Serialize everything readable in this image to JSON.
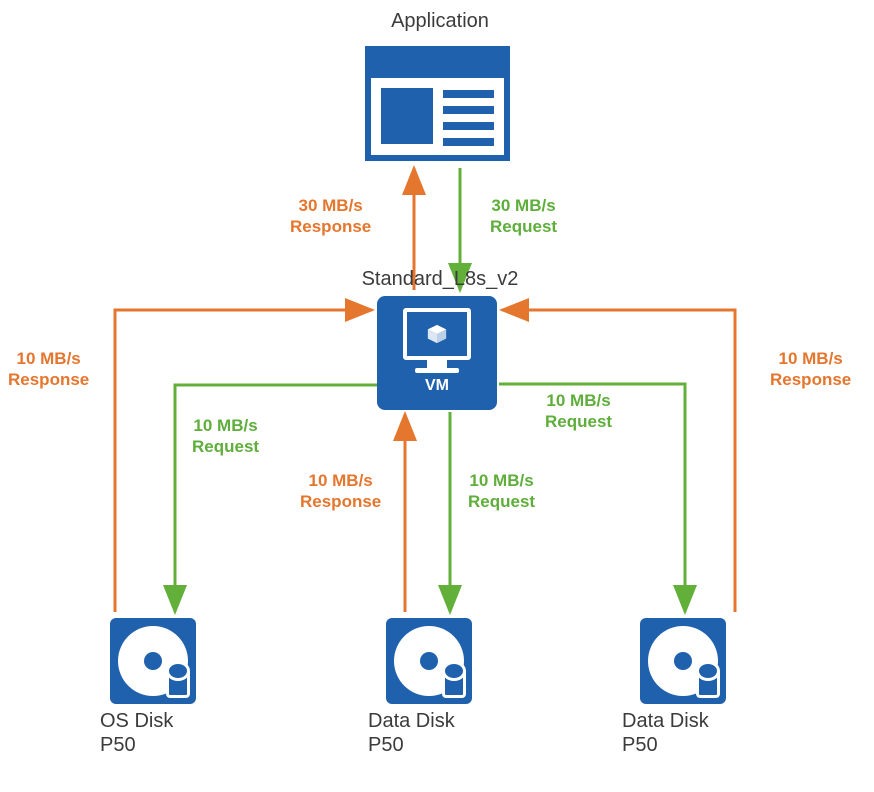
{
  "title": "Application",
  "vm": {
    "sku": "Standard_L8s_v2",
    "label": "VM"
  },
  "disks": {
    "os": {
      "name": "OS Disk",
      "tier": "P50"
    },
    "data1": {
      "name": "Data Disk",
      "tier": "P50"
    },
    "data2": {
      "name": "Data Disk",
      "tier": "P50"
    }
  },
  "flows": {
    "app_request": "30 MB/s\nRequest",
    "app_response": "30 MB/s\nResponse",
    "os_request": "10 MB/s\nRequest",
    "os_response": "10 MB/s\nResponse",
    "d1_request": "10 MB/s\nRequest",
    "d1_response": "10 MB/s\nResponse",
    "d2_request": "10 MB/s\nRequest",
    "d2_response": "10 MB/s\nResponse"
  },
  "colors": {
    "azure_blue": "#1f61ad",
    "request_green": "#62b03a",
    "response_orange": "#e4762e"
  }
}
